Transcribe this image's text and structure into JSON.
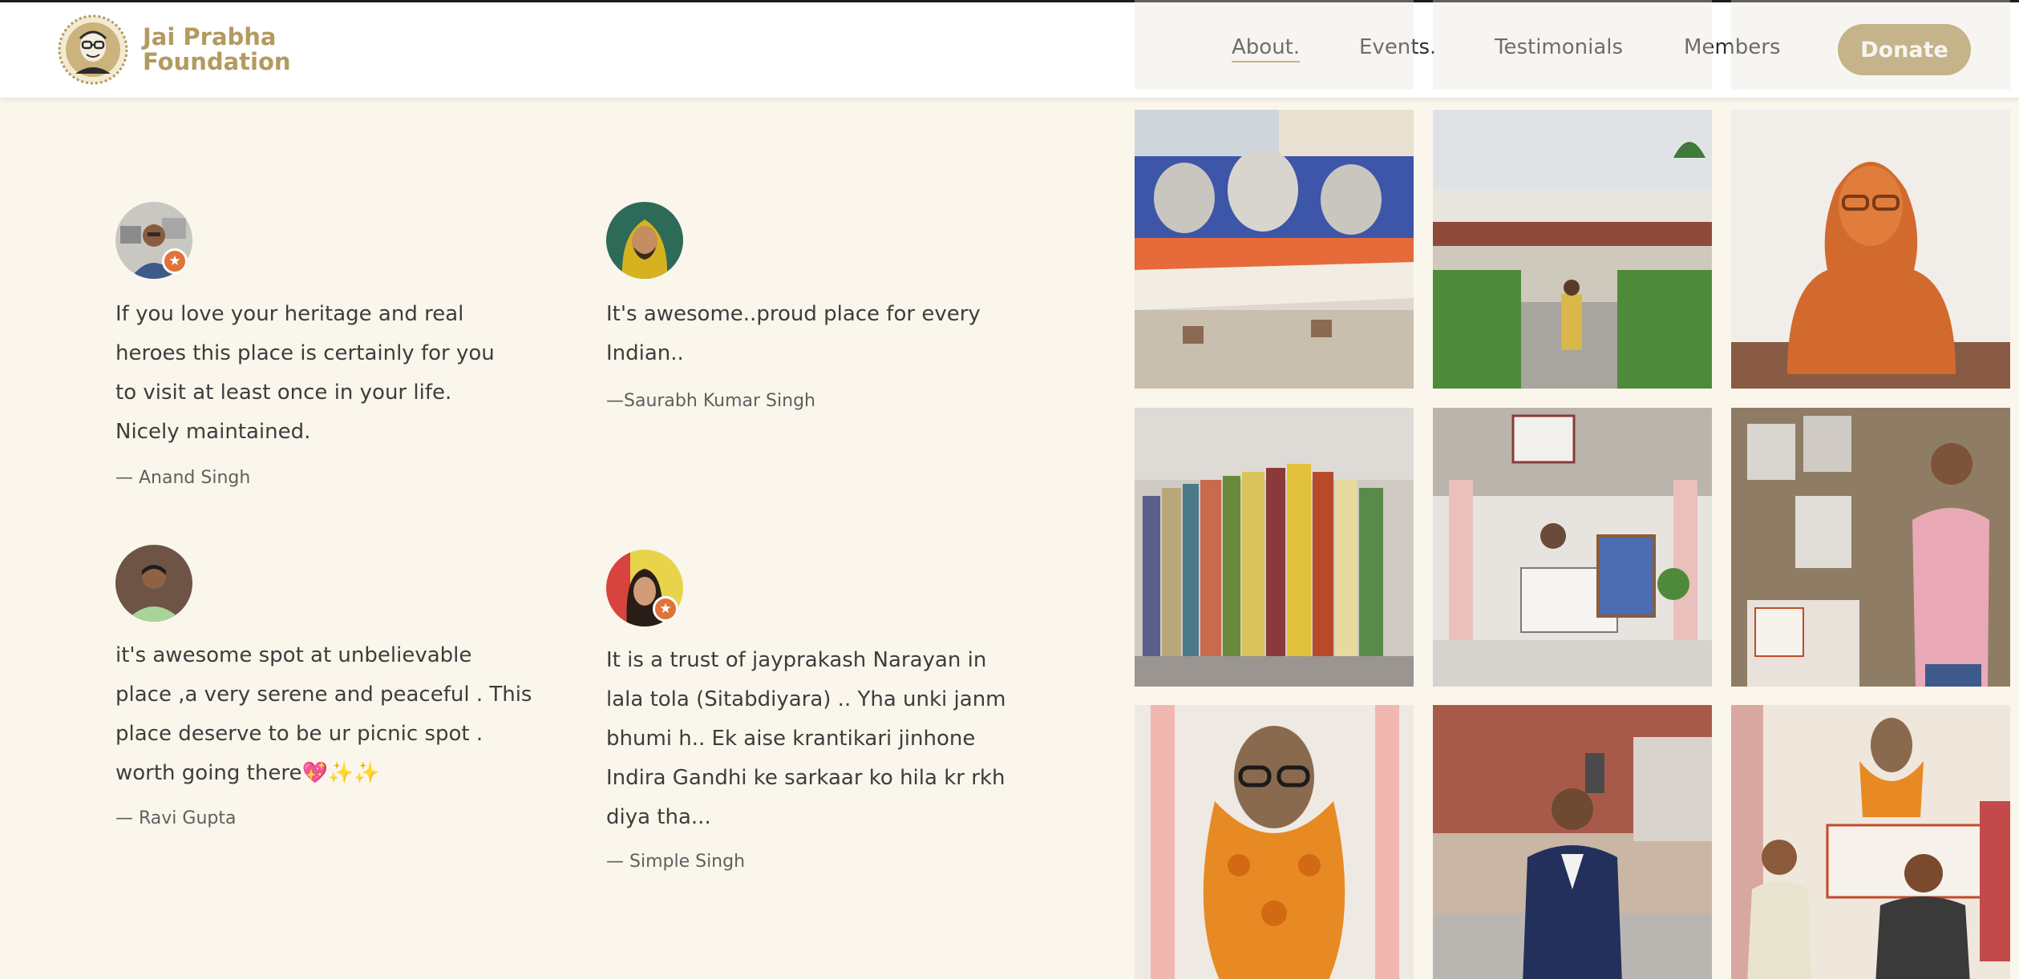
{
  "header": {
    "brand_line1": "Jai Prabha",
    "brand_line2": "Foundation",
    "nav": [
      {
        "label": "About.",
        "active": true
      },
      {
        "label": "Events.",
        "active": false
      },
      {
        "label": "Testimonials",
        "active": false
      },
      {
        "label": "Members",
        "active": false
      }
    ],
    "donate_label": "Donate"
  },
  "testimonials": [
    {
      "quote": "If you love your heritage and real heroes this place is certainly for you to visit at least once in your life. Nicely maintained.",
      "author": "— Anand Singh",
      "badge": true
    },
    {
      "quote": "It's awesome..proud place for every Indian..",
      "author": "—Saurabh Kumar Singh",
      "badge": false
    },
    {
      "quote": "it's awesome spot at unbelievable place ,a very serene and peaceful . This place deserve to be ur picnic spot . worth going there💖✨✨",
      "author": "— Ravi Gupta",
      "badge": false
    },
    {
      "quote": "It is a trust of jayprakash Narayan in lala tola (Sitabdiyara) .. Yha unki janm bhumi h.. Ek aise krantikari jinhone Indira Gandhi ke sarkaar ko hila kr rkh diya tha...",
      "author": "— Simple Singh",
      "badge": true
    }
  ],
  "colors": {
    "brand": "#b39a5e",
    "background": "#faf6ec",
    "badge": "#e0733a"
  }
}
